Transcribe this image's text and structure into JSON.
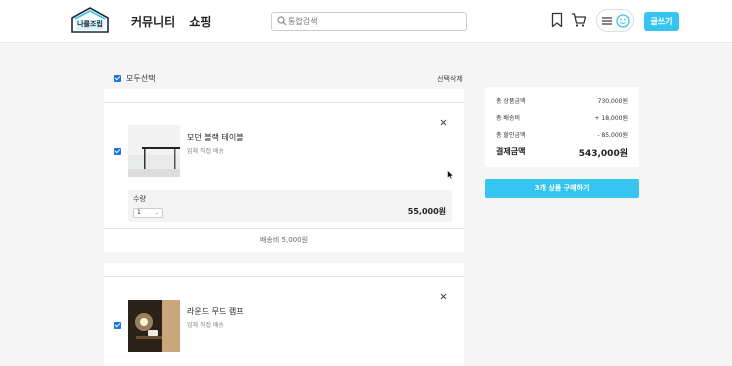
{
  "header": {
    "logo_text": "나를조립",
    "nav": [
      "커뮤니티",
      "쇼핑"
    ],
    "search_placeholder": "통합검색",
    "write_label": "글쓰기"
  },
  "cart": {
    "select_all_label": "모두선택",
    "delete_selected_label": "선택삭제",
    "items": [
      {
        "title": "모던 블랙 테이블",
        "delivery": "업체 직접 배송",
        "qty_label": "수량",
        "qty_value": "1",
        "price": "55,000원",
        "shipping": "배송비 5,000원"
      },
      {
        "title": "라운드 무드 램프",
        "delivery": "업체 직접 배송"
      }
    ]
  },
  "summary": {
    "rows": [
      {
        "label": "총 상품금액",
        "value": "730,000원"
      },
      {
        "label": "총 배송비",
        "value": "+ 18,000원"
      },
      {
        "label": "총 할인금액",
        "value": "- 85,000원"
      }
    ],
    "total_label": "결제금액",
    "total_value": "543,000원",
    "buy_label": "3개 상품 구매하기"
  },
  "colors": {
    "accent": "#35c5f0",
    "checkbox": "#1a73e8",
    "background": "#f5f5f5"
  }
}
